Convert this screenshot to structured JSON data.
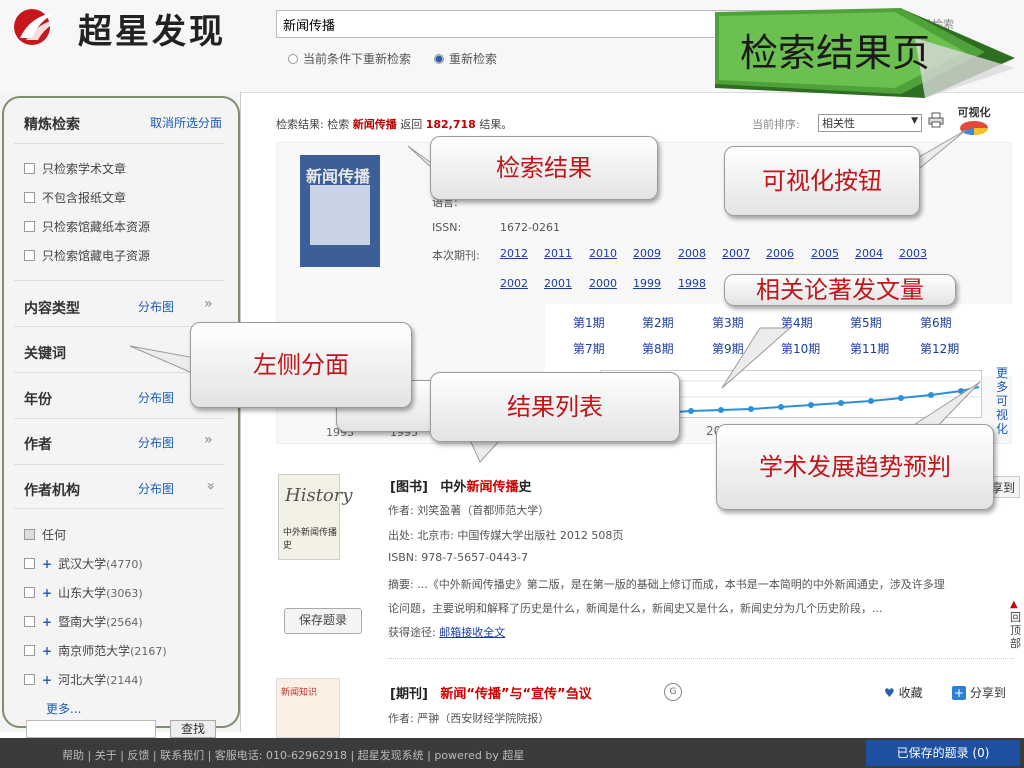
{
  "header": {
    "logo_text": "超星发现",
    "search_value": "新闻传播",
    "advanced_search": "高级检索",
    "radio_within": "当前条件下重新检索",
    "radio_new": "重新检索",
    "banner_title": "检索结果页"
  },
  "facets": {
    "title": "精炼检索",
    "clear": "取消所选分面",
    "checks": [
      "只检索学术文章",
      "不包含报纸文章",
      "只检索馆藏纸本资源",
      "只检索馆藏电子资源"
    ],
    "content_type": "内容类型",
    "keyword": "关键词",
    "year": "年份",
    "author": "作者",
    "org": "作者机构",
    "dist": "分布图",
    "any": "任何",
    "orgs": [
      {
        "name": "武汉大学",
        "count": "(4770)"
      },
      {
        "name": "山东大学",
        "count": "(3063)"
      },
      {
        "name": "暨南大学",
        "count": "(2564)"
      },
      {
        "name": "南京师范大学",
        "count": "(2167)"
      },
      {
        "name": "河北大学",
        "count": "(2144)"
      }
    ],
    "more": "更多...",
    "search_btn": "查找"
  },
  "results": {
    "summary_prefix": "检索结果: 检索",
    "summary_kw": "新闻传播",
    "summary_mid": "返回",
    "summary_num": "182,718",
    "summary_suffix": "结果。",
    "sort_label": "当前排序:",
    "sort_value": "相关性",
    "viz_label": "可视化"
  },
  "journal": {
    "title_partial": "《新",
    "lang_label": "语言:",
    "issn_label": "ISSN:",
    "issn": "1672-0261",
    "issues_label": "本次期刊:",
    "years_row1": [
      "2012",
      "2011",
      "2010",
      "2009",
      "2008",
      "2007",
      "2006",
      "2005",
      "2004",
      "2003"
    ],
    "years_row2": [
      "2002",
      "2001",
      "2000",
      "1999",
      "1998"
    ],
    "issues": [
      "第1期",
      "第2期",
      "第3期",
      "第4期",
      "第5期",
      "第6期",
      "第7期",
      "第8期",
      "第9期",
      "第10期",
      "第11期",
      "第12期"
    ],
    "more_viz": "更多可视化",
    "trend_year_a": "1993",
    "trend_year_b": "1995",
    "trend_year_c": "20"
  },
  "records": [
    {
      "type": "[图书]",
      "title_pre": "中外",
      "title_hl": "新闻传播",
      "title_post": "史",
      "author": "作者: 刘笑盈著（首都师范大学）",
      "source": "出处: 北京市: 中国传媒大学出版社 2012 508页",
      "isbn": "ISBN: 978-7-5657-0443-7",
      "abstract_1": "摘要: ...《中外新闻传播史》第二版，是在第一版的基础上修订而成，本书是一本简明的中外新闻通史，涉及许多理",
      "abstract_2": "论问题，主要说明和解释了历史是什么，新闻是什么，新闻史又是什么，新闻史分为几个历史阶段，...",
      "access_label": "获得途径:",
      "access_link": "邮箱接收全文",
      "save": "保存题录",
      "share_partial": "享到"
    },
    {
      "type": "[期刊]",
      "title": "新闻“传播”与“宣传”刍议",
      "author": "作者: 严翀（西安财经学院院报）",
      "collect": "收藏",
      "share": "分享到"
    }
  ],
  "back_top": "回顶部",
  "callouts": {
    "search_results": "检索结果",
    "viz_button": "可视化按钮",
    "related": "相关论著发文量",
    "left_facet": "左侧分面",
    "result_list": "结果列表",
    "trend": "学术发展趋势预判"
  },
  "footer": {
    "links": "帮助 | 关于 | 反馈 | 联系我们 | 客服电话: 010-62962918 | 超星发现系统 | powered by 超星",
    "saved": "已保存的题录 (0)"
  },
  "colors": {
    "accent_red": "#c0161b",
    "link_blue": "#1a3d9c",
    "banner_green": "#3f8a2f",
    "footer_bg": "#3b3b3b",
    "saved_blue": "#1e4fa0"
  }
}
